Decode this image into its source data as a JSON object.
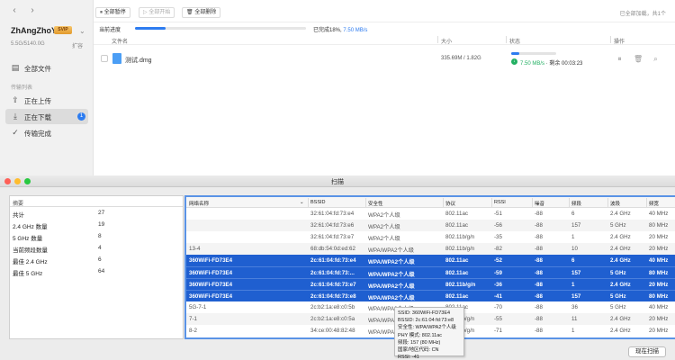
{
  "download_app": {
    "user": {
      "name": "ZhAngZhoYn",
      "vip_badge": "SVIP",
      "storage": "5.5G/5140.0G",
      "expand_label": "扩容"
    },
    "sidebar": {
      "all_files": "全部文件",
      "section_label": "传输列表",
      "items": [
        {
          "label": "正在上传",
          "icon": "upload-icon"
        },
        {
          "label": "正在下载",
          "icon": "download-icon",
          "badge": "1"
        },
        {
          "label": "传输完成",
          "icon": "check-circle-icon"
        }
      ]
    },
    "toolbar": {
      "pause_all": "全部暂停",
      "start_all": "全部开始",
      "delete_all": "全部删除",
      "right_text": "已全部加载，共1个"
    },
    "progress": {
      "label": "当前进度",
      "percent": 18,
      "text": "已完成18%,",
      "speed": "7.50 MB/s"
    },
    "file_table": {
      "headers": {
        "name": "文件名",
        "size": "大小",
        "status": "状态",
        "actions": "操作"
      },
      "rows": [
        {
          "name": "测试.dmg",
          "size": "335.69M / 1.82G",
          "progress": 18,
          "speed": "7.50 MB/s",
          "remaining": "· 剩余 00:03:23"
        }
      ]
    }
  },
  "scan_window": {
    "title": "扫描",
    "summary": {
      "header": "摘要",
      "rows": [
        {
          "label": "共计",
          "value": "27"
        },
        {
          "label": "2.4 GHz 数量",
          "value": "19"
        },
        {
          "label": "5 GHz 数量",
          "value": "8"
        },
        {
          "label": "当前频段数量",
          "value": "4"
        },
        {
          "label": "最佳 2.4 GHz",
          "value": "6"
        },
        {
          "label": "最佳 5 GHz",
          "value": "64"
        }
      ]
    },
    "networks": {
      "headers": [
        "网络名称",
        "BSSID",
        "安全性",
        "协议",
        "RSSI",
        "噪音",
        "频段",
        "波段",
        "频宽"
      ],
      "rows": [
        {
          "cells": [
            "",
            "32:61:04:fd:73:e4",
            "WPA2个人级",
            "802.11ac",
            "-51",
            "-88",
            "6",
            "2.4 GHz",
            "40 MHz"
          ],
          "selected": false
        },
        {
          "cells": [
            "",
            "32:61:04:fd:73:e6",
            "WPA2个人级",
            "802.11ac",
            "-56",
            "-88",
            "157",
            "5 GHz",
            "80 MHz"
          ],
          "selected": false
        },
        {
          "cells": [
            "",
            "32:61:04:fd:73:e7",
            "WPA2个人级",
            "802.11b/g/n",
            "-35",
            "-88",
            "1",
            "2.4 GHz",
            "20 MHz"
          ],
          "selected": false
        },
        {
          "cells": [
            "13-4",
            "68:db:54:0d:ed:62",
            "WPA/WPA2个人级",
            "802.11b/g/n",
            "-82",
            "-88",
            "10",
            "2.4 GHz",
            "20 MHz"
          ],
          "selected": false
        },
        {
          "cells": [
            "360WiFi-FD73E4",
            "2c:61:04:fd:73:e4",
            "WPA/WPA2个人级",
            "802.11ac",
            "-52",
            "-88",
            "6",
            "2.4 GHz",
            "40 MHz"
          ],
          "selected": true
        },
        {
          "cells": [
            "360WiFi-FD73E4",
            "2c:61:04:fd:73:...",
            "WPA/WPA2个人级",
            "802.11ac",
            "-59",
            "-88",
            "157",
            "5 GHz",
            "80 MHz"
          ],
          "selected": true
        },
        {
          "cells": [
            "360WiFi-FD73E4",
            "2c:61:04:fd:73:e7",
            "WPA/WPA2个人级",
            "802.11b/g/n",
            "-36",
            "-88",
            "1",
            "2.4 GHz",
            "20 MHz"
          ],
          "selected": true
        },
        {
          "cells": [
            "360WiFi-FD73E4",
            "2c:61:04:fd:73:e8",
            "WPA/WPA2个人级",
            "802.11ac",
            "-41",
            "-88",
            "157",
            "5 GHz",
            "80 MHz"
          ],
          "selected": true
        },
        {
          "cells": [
            "5G-7-1",
            "2c:b2:1a:e8:c0:5b",
            "WPA/WPA2个人级",
            "802.11ac",
            "-70",
            "-88",
            "36",
            "5 GHz",
            "40 MHz"
          ],
          "selected": false
        },
        {
          "cells": [
            "7-1",
            "2c:b2:1a:e8:c0:5a",
            "WPA/WPA2个人级",
            "802.11b/g/n",
            "-55",
            "-88",
            "11",
            "2.4 GHz",
            "20 MHz"
          ],
          "selected": false
        },
        {
          "cells": [
            "8-2",
            "34:ce:00:48:82:48",
            "WPA/WPA2个人级",
            "802.11b/g/n",
            "-71",
            "-88",
            "1",
            "2.4 GHz",
            "20 MHz"
          ],
          "selected": false
        }
      ]
    },
    "tooltip": {
      "lines": [
        "SSID: 360WiFi-FD73E4",
        "BSSID: 2c:61:04:fd:73:e8",
        "安全性: WPA/WPA2个人级",
        "PHY 模式: 802.11ac",
        "频段: 157 (80 MHz)",
        "国家/地区代码: CN",
        "RSSI: -41"
      ]
    },
    "rescan_label": "现在扫描"
  }
}
